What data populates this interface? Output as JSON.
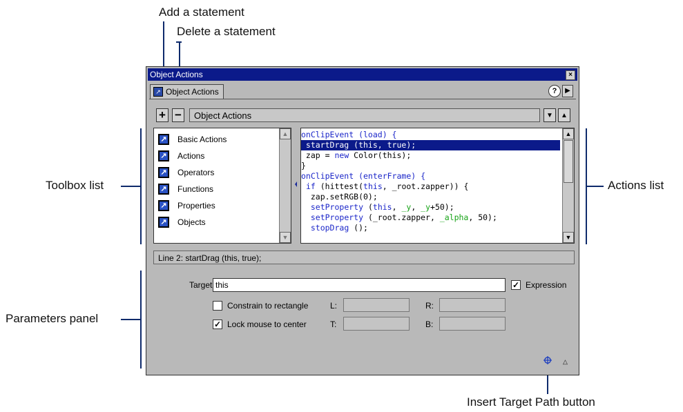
{
  "callouts": {
    "add_statement": "Add a statement",
    "delete_statement": "Delete a statement",
    "toolbox_list": "Toolbox list",
    "actions_list": "Actions list",
    "parameters_panel": "Parameters panel",
    "insert_target_path": "Insert Target Path button"
  },
  "window": {
    "title": "Object Actions",
    "close_glyph": "×",
    "tab_label": "Object Actions",
    "help_glyph": "?",
    "menu_glyph": "▶"
  },
  "toolbar": {
    "add_glyph": "+",
    "delete_glyph": "−",
    "object_name": "Object Actions",
    "move_down_glyph": "▼",
    "move_up_glyph": "▲"
  },
  "toolbox": {
    "items": [
      {
        "label": "Basic Actions"
      },
      {
        "label": "Actions"
      },
      {
        "label": "Operators"
      },
      {
        "label": "Functions"
      },
      {
        "label": "Properties"
      },
      {
        "label": "Objects"
      }
    ]
  },
  "actions_code": {
    "l1a": "onClipEvent (load) {",
    "l2": " startDrag (this, true);",
    "l3a": " zap = ",
    "l3b": "new",
    "l3c": " Color(this);",
    "l4": "}",
    "l5a": "onClipEvent (enterFrame) {",
    "l6a": " ",
    "l6b": "if",
    "l6c": " (hittest(",
    "l6d": "this",
    "l6e": ", _root.zapper)) {",
    "l7": "  zap.setRGB(0);",
    "l8a": "  ",
    "l8b": "setProperty",
    "l8c": " (",
    "l8d": "this",
    "l8e": ", ",
    "l8f": "_y",
    "l8g": ", ",
    "l8h": "_y",
    "l8i": "+50);",
    "l9a": "  ",
    "l9b": "setProperty",
    "l9c": " (_root.zapper, ",
    "l9d": "_alpha",
    "l9e": ", 50);",
    "l10a": "  ",
    "l10b": "stopDrag",
    "l10c": " ();"
  },
  "status": {
    "line_info": "Line 2: startDrag (this, true);"
  },
  "params": {
    "target_label": "Target:",
    "target_value": "this",
    "expression_label": "Expression",
    "expression_checked_glyph": "✓",
    "constrain_label": "Constrain to rectangle",
    "lock_label": "Lock mouse to center",
    "lock_checked_glyph": "✓",
    "l_label": "L:",
    "r_label": "R:",
    "t_label": "T:",
    "b_label": "B:"
  },
  "colors": {
    "titlebar": "#0b1a8a",
    "keyword": "#1b26c9",
    "property": "#17a317",
    "selection": "#0b1a8a"
  },
  "icons": {
    "book": "book-icon",
    "target": "crosshair-target-icon",
    "collapse": "triangle-up-icon"
  }
}
